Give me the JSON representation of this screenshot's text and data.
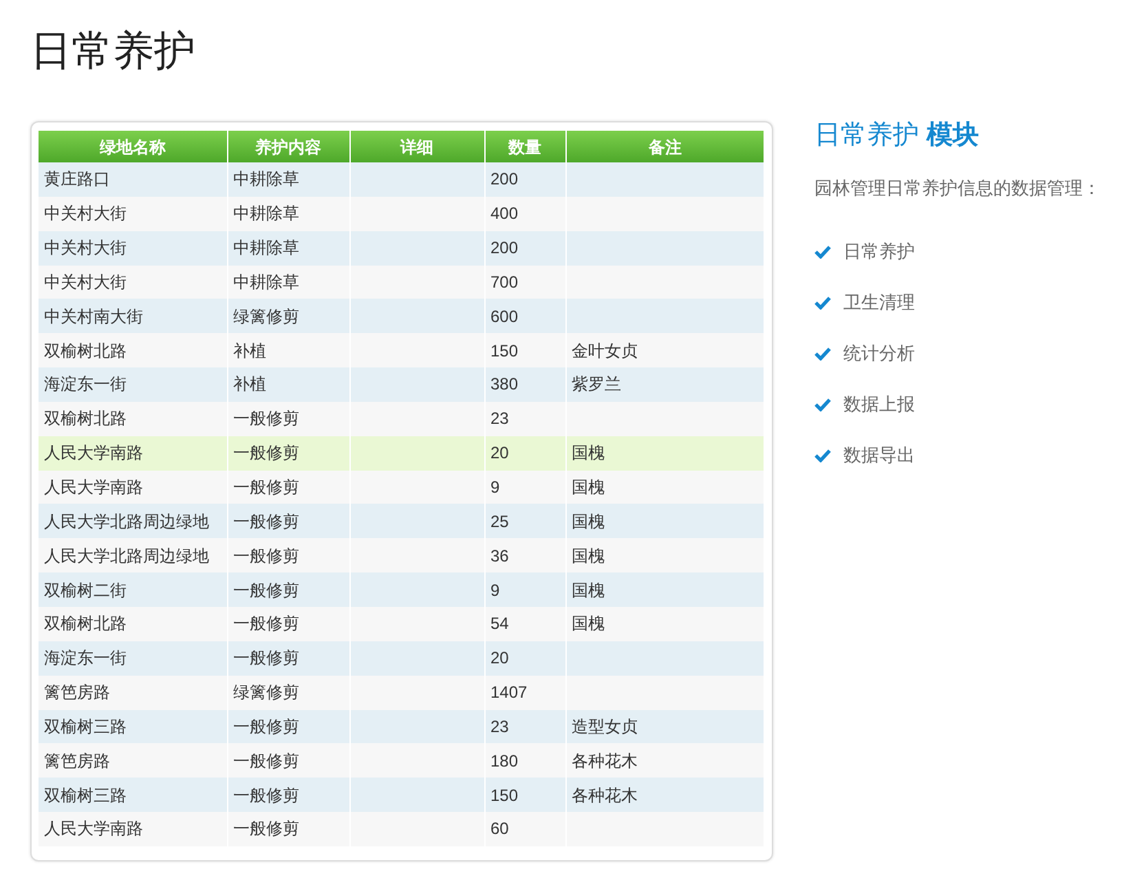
{
  "page_title": "日常养护",
  "table": {
    "columns": [
      "绿地名称",
      "养护内容",
      "详细",
      "数量",
      "备注"
    ],
    "rows": [
      {
        "cells": [
          "黄庄路口",
          "中耕除草",
          "",
          "200",
          ""
        ],
        "selected": false
      },
      {
        "cells": [
          "中关村大街",
          "中耕除草",
          "",
          "400",
          ""
        ],
        "selected": false
      },
      {
        "cells": [
          "中关村大街",
          "中耕除草",
          "",
          "200",
          ""
        ],
        "selected": false
      },
      {
        "cells": [
          "中关村大街",
          "中耕除草",
          "",
          "700",
          ""
        ],
        "selected": false
      },
      {
        "cells": [
          "中关村南大街",
          "绿篱修剪",
          "",
          "600",
          ""
        ],
        "selected": false
      },
      {
        "cells": [
          "双榆树北路",
          "补植",
          "",
          "150",
          "金叶女贞"
        ],
        "selected": false
      },
      {
        "cells": [
          "海淀东一街",
          "补植",
          "",
          "380",
          "紫罗兰"
        ],
        "selected": false
      },
      {
        "cells": [
          "双榆树北路",
          "一般修剪",
          "",
          "23",
          ""
        ],
        "selected": false
      },
      {
        "cells": [
          "人民大学南路",
          "一般修剪",
          "",
          "20",
          "国槐"
        ],
        "selected": true
      },
      {
        "cells": [
          "人民大学南路",
          "一般修剪",
          "",
          "9",
          "国槐"
        ],
        "selected": false
      },
      {
        "cells": [
          "人民大学北路周边绿地",
          "一般修剪",
          "",
          "25",
          "国槐"
        ],
        "selected": false
      },
      {
        "cells": [
          "人民大学北路周边绿地",
          "一般修剪",
          "",
          "36",
          "国槐"
        ],
        "selected": false
      },
      {
        "cells": [
          "双榆树二街",
          "一般修剪",
          "",
          "9",
          "国槐"
        ],
        "selected": false
      },
      {
        "cells": [
          "双榆树北路",
          "一般修剪",
          "",
          "54",
          "国槐"
        ],
        "selected": false
      },
      {
        "cells": [
          "海淀东一街",
          "一般修剪",
          "",
          "20",
          ""
        ],
        "selected": false
      },
      {
        "cells": [
          "篱笆房路",
          "绿篱修剪",
          "",
          "1407",
          ""
        ],
        "selected": false
      },
      {
        "cells": [
          "双榆树三路",
          "一般修剪",
          "",
          "23",
          "造型女贞"
        ],
        "selected": false
      },
      {
        "cells": [
          "篱笆房路",
          "一般修剪",
          "",
          "180",
          "各种花木"
        ],
        "selected": false
      },
      {
        "cells": [
          "双榆树三路",
          "一般修剪",
          "",
          "150",
          "各种花木"
        ],
        "selected": false
      },
      {
        "cells": [
          "人民大学南路",
          "一般修剪",
          "",
          "60",
          ""
        ],
        "selected": false
      }
    ]
  },
  "module": {
    "title": "日常养护 **模块**",
    "description": "园林管理日常养护信息的数据管理：",
    "features": [
      "日常养护",
      "卫生清理",
      "统计分析",
      "数据上报",
      "数据导出"
    ]
  }
}
